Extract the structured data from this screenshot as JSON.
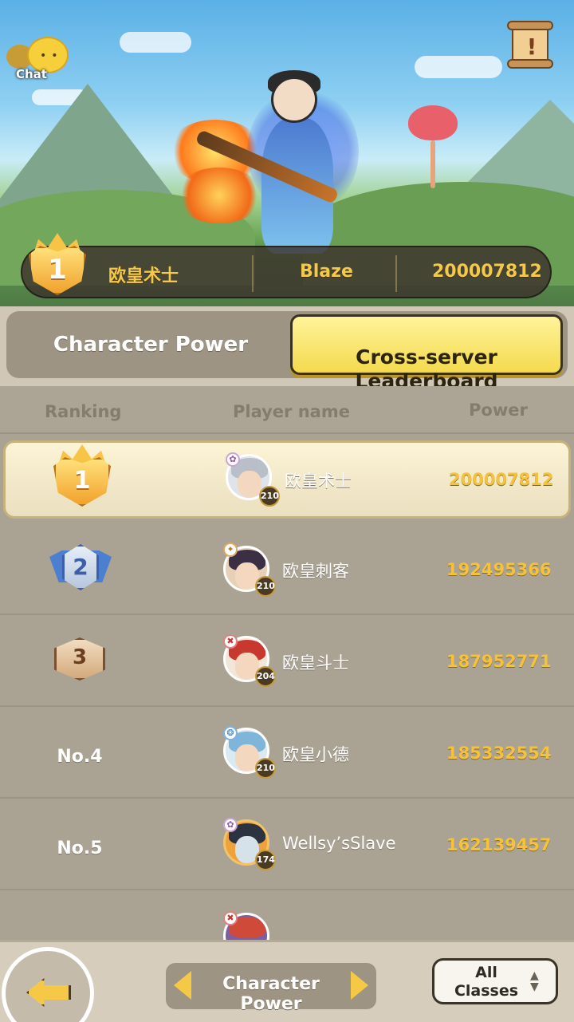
{
  "chat": {
    "label": "Chat"
  },
  "top_player": {
    "rank": "1",
    "name": "欧皇术士",
    "server": "Blaze",
    "power": "200007812"
  },
  "tabs": [
    {
      "label": "Character Power",
      "active": false
    },
    {
      "label": "Cross-server\nLeaderboard",
      "active": true
    }
  ],
  "columns": {
    "ranking": "Ranking",
    "player_name": "Player name",
    "power": "Power"
  },
  "rows": [
    {
      "rank": "1",
      "name": "欧皇术士",
      "level": "210",
      "power": "200007812"
    },
    {
      "rank": "2",
      "name": "欧皇刺客",
      "level": "210",
      "power": "192495366"
    },
    {
      "rank": "3",
      "name": "欧皇斗士",
      "level": "204",
      "power": "187952771"
    },
    {
      "rank": "No.4",
      "name": "欧皇小德",
      "level": "210",
      "power": "185332554"
    },
    {
      "rank": "No.5",
      "name": "Wellsy’sSlave",
      "level": "174",
      "power": "162139457"
    }
  ],
  "bottom": {
    "selector_label": "Character Power",
    "classes_label": "All\nClasses"
  },
  "colors": {
    "gold": "#f6c23c",
    "tab_active": "#f4da4e",
    "panel": "#aaa394"
  }
}
